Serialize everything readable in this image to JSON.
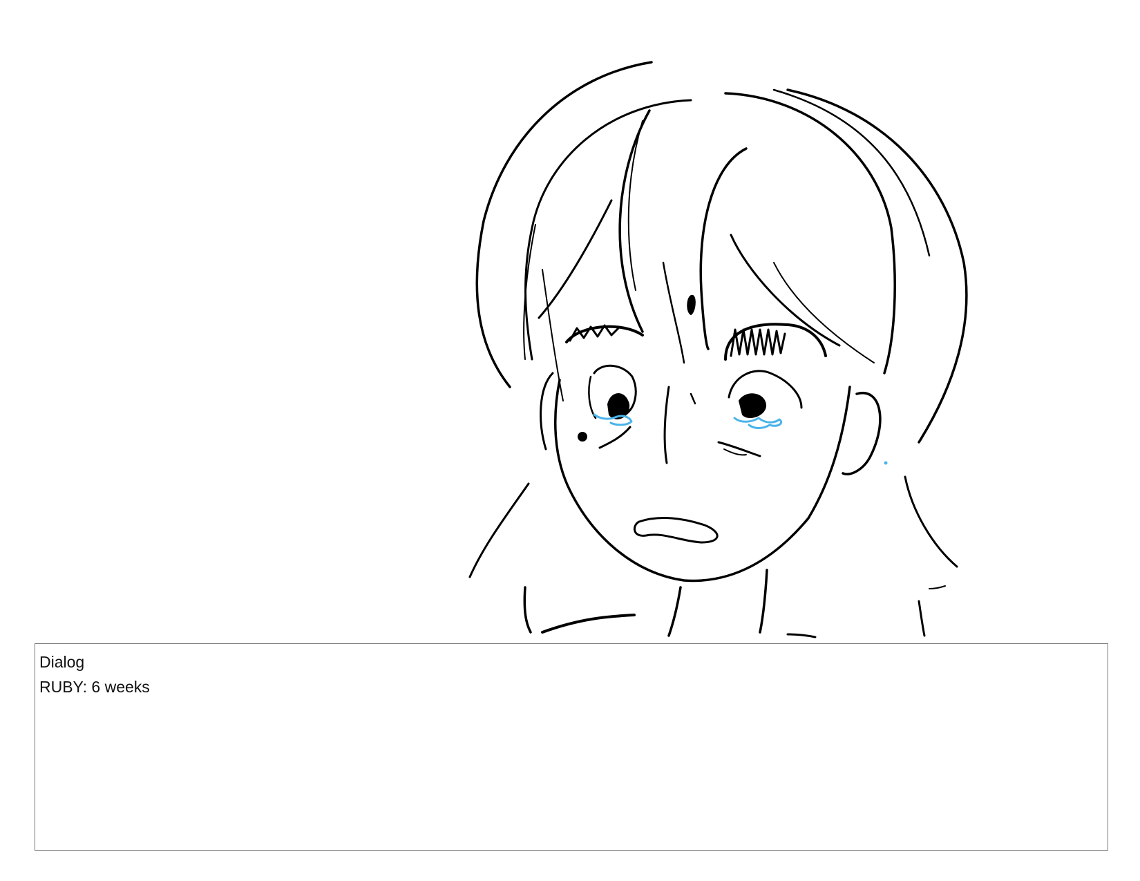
{
  "dialog": {
    "label": "Dialog",
    "line": "RUBY: 6 weeks"
  },
  "colors": {
    "ink": "#000000",
    "tears": "#4ab3ea",
    "box_border": "#777777"
  }
}
